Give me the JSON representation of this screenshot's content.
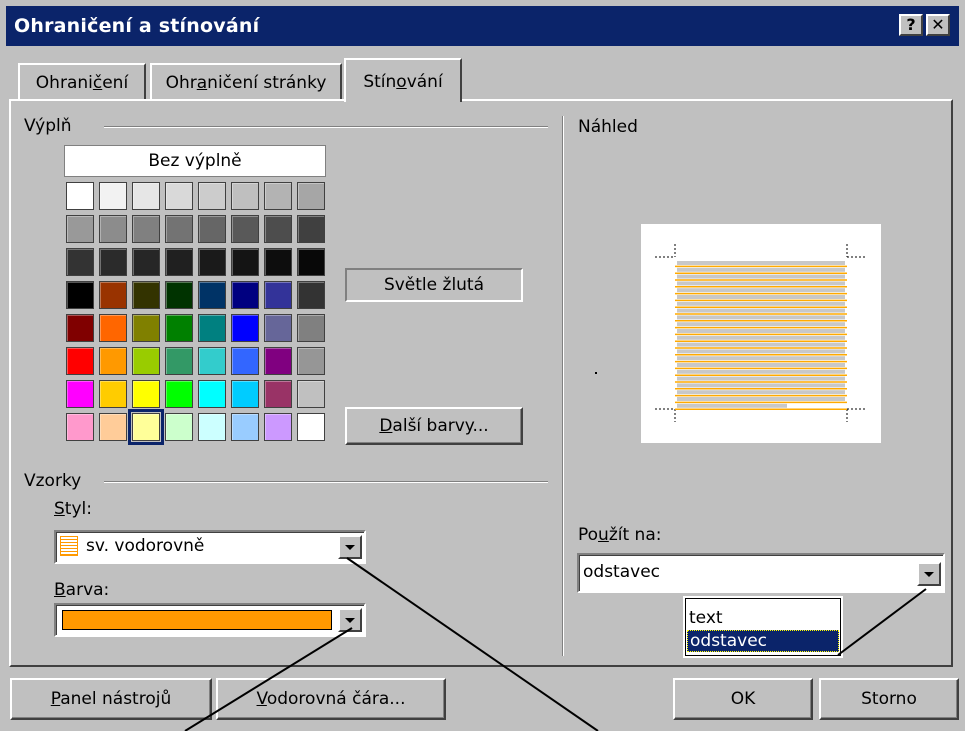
{
  "window": {
    "title": "Ohraničení a stínování"
  },
  "titlebar_buttons": {
    "help": "?",
    "close": "✕"
  },
  "tabs": [
    {
      "label_pre": "Ohrani",
      "label_u": "č",
      "label_post": "ení"
    },
    {
      "label_pre": "Ohr",
      "label_u": "a",
      "label_post": "ničení stránky"
    },
    {
      "label_pre": "Stín",
      "label_u": "o",
      "label_post": "vání"
    }
  ],
  "fill": {
    "group_label": "Výplň",
    "no_fill_label": "Bez výplně",
    "selected_color_name": "Světle žlutá",
    "more_colors": {
      "u": "D",
      "rest": "alší barvy..."
    },
    "palette": [
      [
        "#ffffff",
        "#f2f2f2",
        "#e6e6e6",
        "#d9d9d9",
        "#cccccc",
        "#bfbfbf",
        "#b3b3b3",
        "#a6a6a6"
      ],
      [
        "#999999",
        "#8c8c8c",
        "#808080",
        "#737373",
        "#666666",
        "#595959",
        "#4d4d4d",
        "#404040"
      ],
      [
        "#333333",
        "#2b2b2b",
        "#262626",
        "#202020",
        "#1a1a1a",
        "#141414",
        "#0d0d0d",
        "#080808"
      ],
      [
        "#000000",
        "#993300",
        "#333300",
        "#003300",
        "#003366",
        "#000080",
        "#333399",
        "#333333"
      ],
      [
        "#800000",
        "#ff6600",
        "#808000",
        "#008000",
        "#008080",
        "#0000ff",
        "#666699",
        "#808080"
      ],
      [
        "#ff0000",
        "#ff9900",
        "#99cc00",
        "#339966",
        "#33cccc",
        "#3366ff",
        "#800080",
        "#969696"
      ],
      [
        "#ff00ff",
        "#ffcc00",
        "#ffff00",
        "#00ff00",
        "#00ffff",
        "#00ccff",
        "#993366",
        "#c0c0c0"
      ],
      [
        "#ff99cc",
        "#ffcc99",
        "#ffff99",
        "#ccffcc",
        "#ccffff",
        "#99ccff",
        "#cc99ff",
        "#ffffff"
      ]
    ]
  },
  "patterns": {
    "group_label": "Vzorky",
    "style_label": {
      "u": "S",
      "rest": "tyl:"
    },
    "style_value": "sv. vodorovně",
    "color_label": {
      "u": "B",
      "rest": "arva:"
    },
    "color_value": "#ff9900"
  },
  "preview": {
    "group_label": "Náhled",
    "apply_label": {
      "pre": "Po",
      "u": "u",
      "post": "žít na:"
    },
    "apply_value": "odstavec",
    "apply_options": [
      "text",
      "odstavec"
    ]
  },
  "footer": {
    "toolbar_button": {
      "u": "P",
      "rest": "anel nástrojů"
    },
    "hline_button": {
      "u": "V",
      "rest": "odorovná čára..."
    },
    "ok": "OK",
    "cancel": "Storno"
  }
}
